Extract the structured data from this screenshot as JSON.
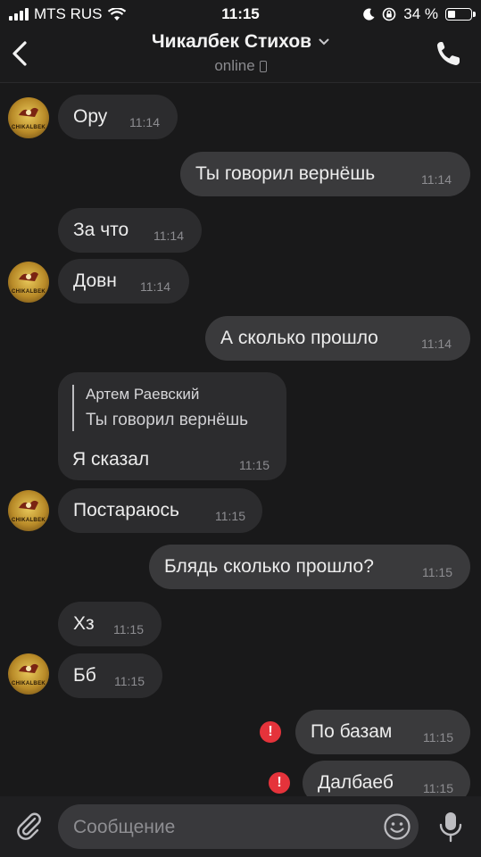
{
  "status_bar": {
    "carrier": "MTS RUS",
    "time": "11:15",
    "battery": "34 %",
    "battery_level": 0.34
  },
  "header": {
    "title": "Чикалбек Стихов",
    "subtitle": "online"
  },
  "avatar_label": "CHIKALBEK",
  "messages": [
    {
      "text": "Ору",
      "time": "11:14",
      "direction": "in"
    },
    {
      "text": "Ты говорил вернёшь",
      "time": "11:14",
      "direction": "out"
    },
    {
      "text": "За что",
      "time": "11:14",
      "direction": "in"
    },
    {
      "text": "Довн",
      "time": "11:14",
      "direction": "in"
    },
    {
      "text": "А сколько прошло",
      "time": "11:14",
      "direction": "out"
    },
    {
      "text": "Я сказал",
      "time": "11:15",
      "direction": "in",
      "reply_to": {
        "author": "Артем Раевский",
        "text": "Ты говорил вернёшь"
      }
    },
    {
      "text": "Постараюсь",
      "time": "11:15",
      "direction": "in"
    },
    {
      "text": "Блядь сколько прошло?",
      "time": "11:15",
      "direction": "out"
    },
    {
      "text": "Хз",
      "time": "11:15",
      "direction": "in"
    },
    {
      "text": "Бб",
      "time": "11:15",
      "direction": "in"
    },
    {
      "text": "По базам",
      "time": "11:15",
      "direction": "out",
      "error": true
    },
    {
      "text": "Далбаеб",
      "time": "11:15",
      "direction": "out",
      "error": true
    }
  ],
  "error_symbol": "!",
  "input": {
    "placeholder": "Сообщение"
  },
  "colors": {
    "background": "#19191a",
    "incoming_bubble": "#2c2c2e",
    "outgoing_bubble": "#3a3a3c",
    "error": "#e5333b"
  },
  "icons": {
    "back": "chevron-left-icon",
    "call": "phone-icon",
    "attach": "paperclip-icon",
    "emoji": "emoji-icon",
    "mic": "microphone-icon"
  }
}
